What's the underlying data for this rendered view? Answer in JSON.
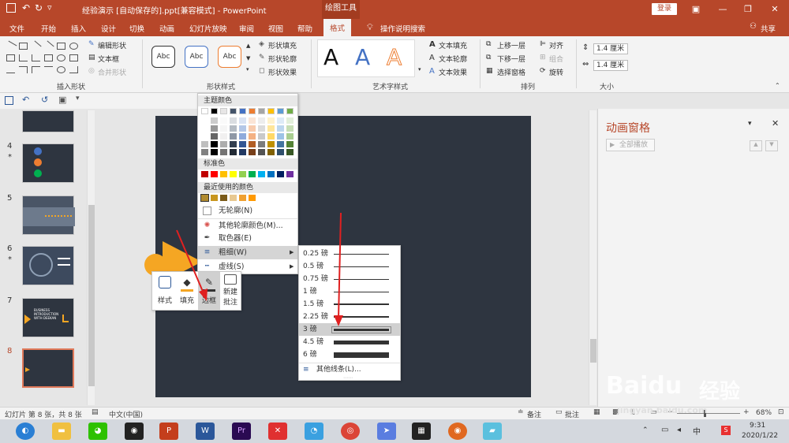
{
  "titlebar": {
    "title": "经验演示 [自动保存的].ppt[兼容模式] - PowerPoint",
    "context_tab": "绘图工具",
    "login": "登录"
  },
  "tabs": [
    "文件",
    "开始",
    "插入",
    "设计",
    "切换",
    "动画",
    "幻灯片放映",
    "审阅",
    "视图",
    "帮助",
    "格式"
  ],
  "tell_me": "操作说明搜索",
  "share": "共享",
  "ribbon": {
    "insert_shapes": {
      "label": "插入形状",
      "edit_shape": "编辑形状",
      "textbox": "文本框",
      "merge_shapes": "合并形状"
    },
    "shape_styles": {
      "label": "形状样式",
      "style_sample": "Abc",
      "fill": "形状填充",
      "outline": "形状轮廓",
      "effects": "形状效果"
    },
    "wordart": {
      "label": "艺术字样式",
      "letter": "A",
      "text_fill": "文本填充",
      "text_outline": "文本轮廓",
      "text_effects": "文本效果"
    },
    "arrange": {
      "label": "排列",
      "bring_forward": "上移一层",
      "send_backward": "下移一层",
      "selection_pane": "选择窗格",
      "align": "对齐",
      "group": "组合",
      "rotate": "旋转"
    },
    "size": {
      "label": "大小",
      "height": "1.4 厘米",
      "width": "1.4 厘米"
    }
  },
  "slides": {
    "numbers": [
      "4",
      "5",
      "6",
      "7",
      "8"
    ],
    "thumb7_text": "BUSINESS INTRODUCTION WITH DEEKAN"
  },
  "color_menu": {
    "theme_colors": "主题颜色",
    "standard_colors": "标准色",
    "recent_colors": "最近使用的颜色",
    "no_outline": "无轮廓(N)",
    "more_colors": "其他轮廓颜色(M)...",
    "eyedropper": "取色器(E)",
    "weight": "粗细(W)",
    "dashes": "虚线(S)"
  },
  "theme_palette": {
    "top": [
      "#ffffff",
      "#000000",
      "#e7e6e6",
      "#44546a",
      "#4472c4",
      "#ed7d31",
      "#a5a5a5",
      "#ffc000",
      "#5b9bd5",
      "#70ad47"
    ]
  },
  "standard_palette": [
    "#c00000",
    "#ff0000",
    "#ffc000",
    "#ffff00",
    "#92d050",
    "#00b050",
    "#00b0f0",
    "#0070c0",
    "#002060",
    "#7030a0"
  ],
  "recent_palette": [
    "#b08a2e",
    "#c8961e",
    "#7a5a18",
    "#e8c890",
    "#f0a030",
    "#ff9900"
  ],
  "weight_menu": {
    "items": [
      "0.25 磅",
      "0.5 磅",
      "0.75 磅",
      "1 磅",
      "1.5 磅",
      "2.25 磅",
      "3 磅",
      "4.5 磅",
      "6 磅"
    ],
    "selected": "3 磅",
    "more": "其他线条(L)..."
  },
  "mini_toolbar": {
    "style": "样式",
    "fill": "填充",
    "outline": "边框",
    "new_comment_1": "新建",
    "new_comment_2": "批注"
  },
  "anim_pane": {
    "title": "动画窗格",
    "play_all": "全部播放"
  },
  "statusbar": {
    "slide_info": "幻灯片 第 8 张，共 8 张",
    "language": "中文(中国)",
    "notes": "备注",
    "comments": "批注",
    "zoom": "68%"
  },
  "taskbar": {
    "time": "9:31",
    "date": "2020/1/22"
  },
  "watermark": {
    "brand": "Baidu",
    "cn": "经验",
    "url": "jingyan.baidu.com"
  },
  "colors": {
    "accent": "#b7472a",
    "slide_bg": "#2e3540",
    "orange": "#f5a623",
    "arrow_red": "#e02020"
  }
}
